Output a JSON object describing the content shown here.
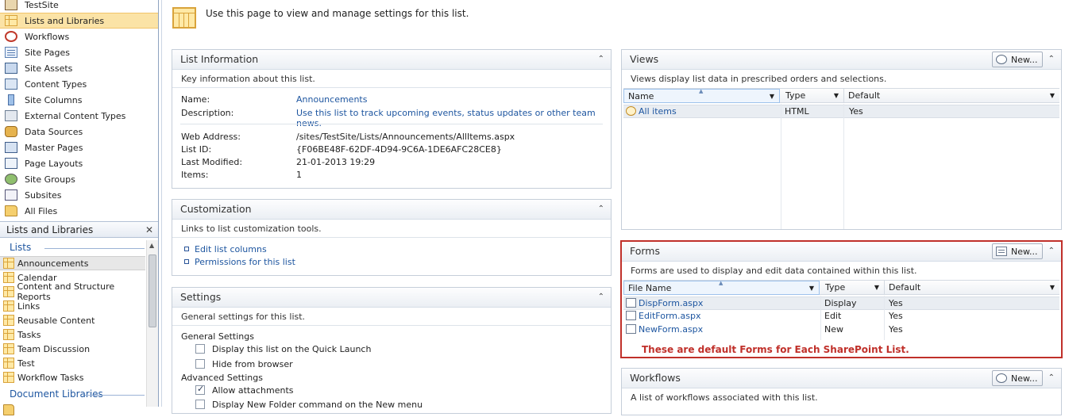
{
  "nav": {
    "items": [
      {
        "label": "TestSite",
        "icon": "house-icon"
      },
      {
        "label": "Lists and Libraries",
        "icon": "list-icon",
        "active": true
      },
      {
        "label": "Workflows",
        "icon": "workflow-icon"
      },
      {
        "label": "Site Pages",
        "icon": "site-pages-icon"
      },
      {
        "label": "Site Assets",
        "icon": "site-assets-icon"
      },
      {
        "label": "Content Types",
        "icon": "content-types-icon"
      },
      {
        "label": "Site Columns",
        "icon": "site-columns-icon"
      },
      {
        "label": "External Content Types",
        "icon": "external-content-types-icon"
      },
      {
        "label": "Data Sources",
        "icon": "data-sources-icon"
      },
      {
        "label": "Master Pages",
        "icon": "master-pages-icon"
      },
      {
        "label": "Page Layouts",
        "icon": "page-layouts-icon"
      },
      {
        "label": "Site Groups",
        "icon": "site-groups-icon"
      },
      {
        "label": "Subsites",
        "icon": "subsites-icon"
      },
      {
        "label": "All Files",
        "icon": "folder-icon"
      }
    ],
    "section_header": "Lists and Libraries",
    "close_glyph": "✕",
    "lists_heading": "Lists",
    "lists": [
      {
        "label": "Announcements",
        "active": true
      },
      {
        "label": "Calendar"
      },
      {
        "label": "Content and Structure Reports"
      },
      {
        "label": "Links"
      },
      {
        "label": "Reusable Content"
      },
      {
        "label": "Tasks"
      },
      {
        "label": "Team Discussion"
      },
      {
        "label": "Test"
      },
      {
        "label": "Workflow Tasks"
      }
    ],
    "doclib_heading": "Document Libraries"
  },
  "page": {
    "intro": "Use this page to view and manage settings for this list."
  },
  "list_info": {
    "title": "List Information",
    "desc": "Key information about this list.",
    "name_label": "Name:",
    "name_value": "Announcements",
    "description_label": "Description:",
    "description_value": "Use this list to track upcoming events, status updates or other team news.",
    "web_address_label": "Web Address:",
    "web_address_value": "/sites/TestSite/Lists/Announcements/AllItems.aspx",
    "list_id_label": "List ID:",
    "list_id_value": "{F06BE48F-62DF-4D94-9C6A-1DE6AFC28CE8}",
    "last_modified_label": "Last Modified:",
    "last_modified_value": "21-01-2013 19:29",
    "items_label": "Items:",
    "items_value": "1"
  },
  "customization": {
    "title": "Customization",
    "desc": "Links to list customization tools.",
    "links": [
      "Edit list columns",
      "Permissions for this list"
    ]
  },
  "settings": {
    "title": "Settings",
    "desc": "General settings for this list.",
    "general_heading": "General Settings",
    "quick_launch": "Display this list on the Quick Launch",
    "hide_browser": "Hide from browser",
    "advanced_heading": "Advanced Settings",
    "allow_attachments": "Allow attachments",
    "new_folder": "Display New Folder command on the New menu"
  },
  "views": {
    "title": "Views",
    "new_label": "New...",
    "desc": "Views display list data in prescribed orders and selections.",
    "columns": [
      "Name",
      "Type",
      "Default"
    ],
    "rows": [
      {
        "name": "All items",
        "type": "HTML",
        "default": "Yes"
      }
    ]
  },
  "forms": {
    "title": "Forms",
    "new_label": "New...",
    "desc": "Forms are used to display and edit data contained within this list.",
    "columns": [
      "File Name",
      "Type",
      "Default"
    ],
    "rows": [
      {
        "name": "DispForm.aspx",
        "type": "Display",
        "default": "Yes"
      },
      {
        "name": "EditForm.aspx",
        "type": "Edit",
        "default": "Yes"
      },
      {
        "name": "NewForm.aspx",
        "type": "New",
        "default": "Yes"
      }
    ],
    "note": "These are default Forms for Each SharePoint List.",
    "highlight_color": "#c0302a"
  },
  "workflows": {
    "title": "Workflows",
    "new_label": "New...",
    "desc": "A list of workflows associated with this list."
  },
  "glyphs": {
    "collapse": "⌃",
    "dropdown": "▼",
    "sort": "▲",
    "scroll_up": "▲"
  }
}
